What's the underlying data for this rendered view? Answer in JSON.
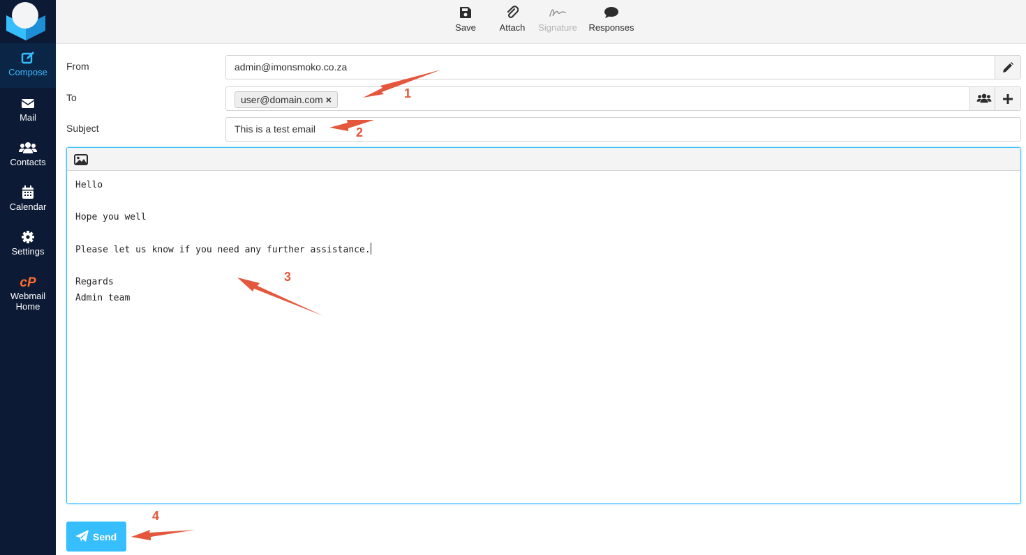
{
  "sidebar": {
    "items": [
      {
        "label": "Compose",
        "icon": "compose-icon"
      },
      {
        "label": "Mail",
        "icon": "mail-icon"
      },
      {
        "label": "Contacts",
        "icon": "contacts-icon"
      },
      {
        "label": "Calendar",
        "icon": "calendar-icon"
      },
      {
        "label": "Settings",
        "icon": "gear-icon"
      },
      {
        "label_line1": "Webmail",
        "label_line2": "Home",
        "icon": "cpanel-icon"
      }
    ]
  },
  "toolbar": {
    "save_label": "Save",
    "attach_label": "Attach",
    "signature_label": "Signature",
    "responses_label": "Responses"
  },
  "form": {
    "from_label": "From",
    "from_value": "admin@imonsmoko.co.za",
    "to_label": "To",
    "to_recipient": "user@domain.com",
    "to_remove": "×",
    "subject_label": "Subject",
    "subject_value": "This is a test email"
  },
  "editor": {
    "lines": [
      "Hello",
      "",
      "Hope you well",
      "",
      "Please let us know if you need any further assistance.",
      "",
      "Regards",
      "Admin team"
    ]
  },
  "send_label": "Send",
  "annotations": [
    "1",
    "2",
    "3",
    "4"
  ],
  "colors": {
    "sidebar_bg": "#0c1a35",
    "accent": "#37beff",
    "annotation": "#e4573d"
  }
}
